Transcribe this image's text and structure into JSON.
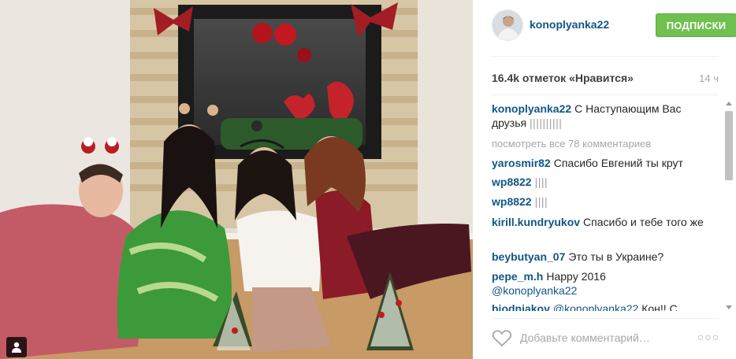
{
  "post": {
    "username": "konoplyanka22",
    "follow_label": "ПОДПИСКИ",
    "likes_text": "16.4k отметок «Нравится»",
    "age": "14 ч",
    "comment_placeholder": "Добавьте комментарий…",
    "more_label": "○○○",
    "view_all_text": "посмотреть все 78 комментариев"
  },
  "caption": {
    "user": "konoplyanka22",
    "text": "С Наступающим Вас друзья",
    "bars": "||||||||||"
  },
  "comments": [
    {
      "user": "yarosmir82",
      "text": "Спасибо Евгений ты крут"
    },
    {
      "user": "wp8822",
      "text": "||||"
    },
    {
      "user": "wp8822",
      "text": "||||"
    },
    {
      "user": "kirill.kundryukov",
      "text": "Спасибо и тебе того же"
    },
    {
      "user": "beybutyan_07",
      "text": "Это ты в Украине?"
    },
    {
      "user": "pepe_m.h",
      "text": "Happy 2016",
      "mention": "@konoplyanka22"
    },
    {
      "user": "biodniakov",
      "text": "Кон!! С",
      "mention": "@konoplyanka22"
    }
  ],
  "icons": {
    "user_tag": "person-icon",
    "heart": "heart-outline-icon",
    "more": "ellipsis-icon"
  },
  "colors": {
    "link": "#125688",
    "follow_green": "#70c050",
    "muted": "#a5a7aa"
  }
}
